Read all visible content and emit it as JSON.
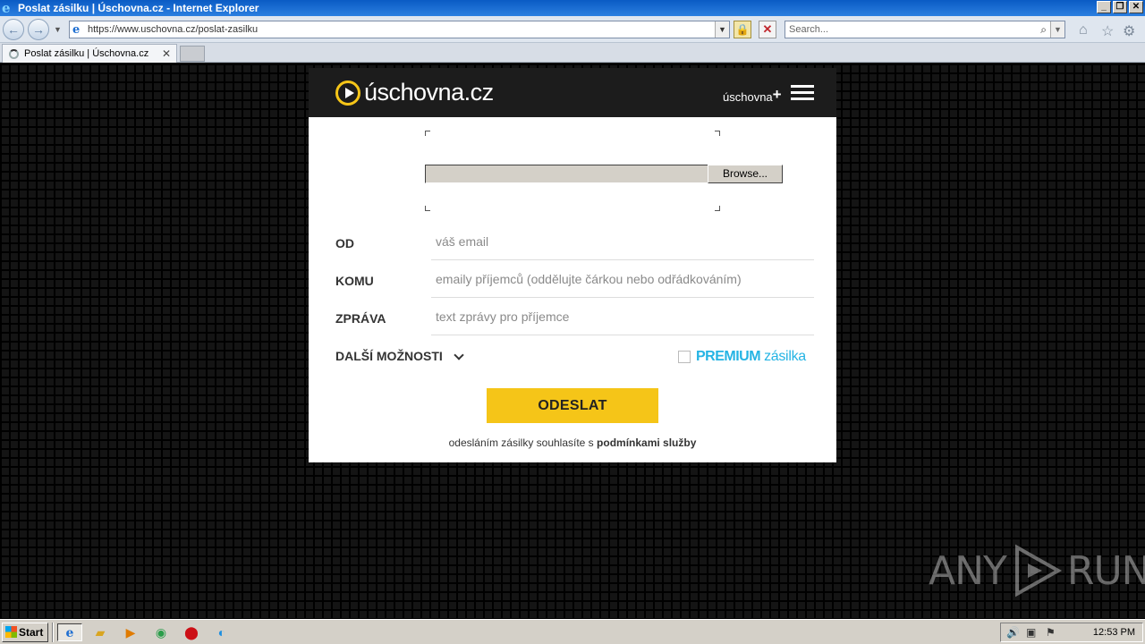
{
  "window": {
    "title": "Poslat zásilku | Úschovna.cz - Internet Explorer",
    "min": "_",
    "max": "❐",
    "close": "✕"
  },
  "browser": {
    "url": "https://www.uschovna.cz/poslat-zasilku",
    "search_placeholder": "Search...",
    "tab_title": "Poslat zásilku | Úschovna.cz",
    "tab_close": "✕"
  },
  "site": {
    "logo_text": "úschovna.cz",
    "uschovna_plus_label": "úschovna",
    "plus_sign": "+",
    "browse_label": "Browse...",
    "form": {
      "from_label": "OD",
      "from_placeholder": "váš email",
      "to_label": "KOMU",
      "to_placeholder": "emaily příjemců (oddělujte čárkou nebo odřádkováním)",
      "message_label": "ZPRÁVA",
      "message_placeholder": "text zprávy pro příjemce",
      "more_options_label": "DALŠÍ MOŽNOSTI",
      "premium_strong": "PREMIUM",
      "premium_light": "zásilka",
      "submit_label": "ODESLAT",
      "terms_prefix": "odesláním zásilky souhlasíte s ",
      "terms_link": "podmínkami služby"
    }
  },
  "watermark": {
    "left": "ANY",
    "right": "RUN"
  },
  "taskbar": {
    "start_label": "Start",
    "clock": "12:53 PM"
  },
  "colors": {
    "brand_yellow": "#f5c518",
    "premium_blue": "#25b4e4",
    "header_dark": "#1c1c1c"
  }
}
